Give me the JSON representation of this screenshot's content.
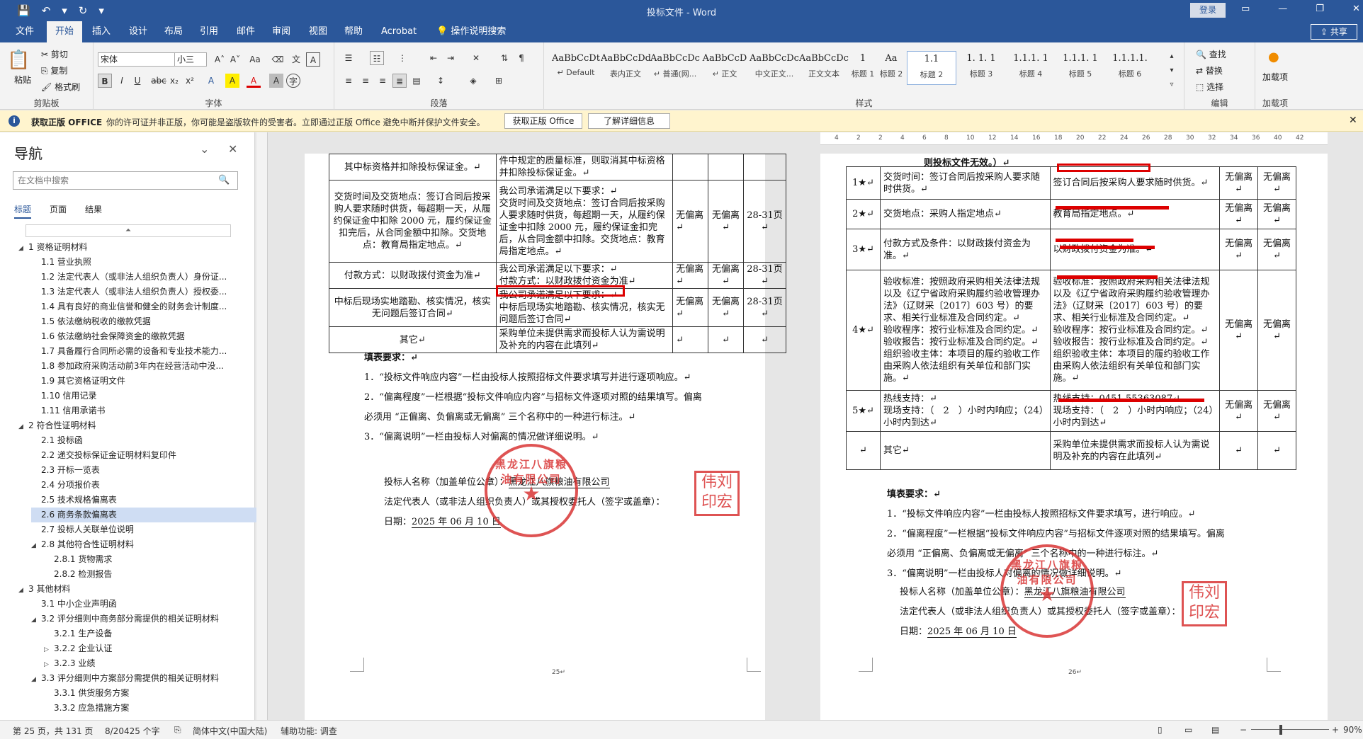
{
  "window": {
    "title": "投标文件 - Word",
    "login": "登录",
    "qat": [
      "💾",
      "↶",
      "▾",
      "↻",
      "▾"
    ],
    "winbtns": [
      "▭",
      "—",
      "❐",
      "✕"
    ]
  },
  "menu": {
    "tabs": [
      "文件",
      "开始",
      "插入",
      "设计",
      "布局",
      "引用",
      "邮件",
      "审阅",
      "视图",
      "帮助",
      "Acrobat",
      "操作说明搜索"
    ],
    "active": "开始",
    "share": "共享"
  },
  "ribbon": {
    "clipboard": {
      "paste": "粘贴",
      "cut": "剪切",
      "copy": "复制",
      "format_painter": "格式刷",
      "label": "剪贴板"
    },
    "font": {
      "name": "宋体",
      "size": "小三",
      "label": "字体",
      "buttons": [
        "B",
        "I",
        "U",
        "abc",
        "x₂",
        "x²",
        "A",
        "A",
        "A",
        "A"
      ],
      "top_buttons": [
        "A˄",
        "A˅",
        "Aa",
        "A"
      ]
    },
    "paragraph": {
      "label": "段落"
    },
    "styles": {
      "label": "样式",
      "items": [
        {
          "sample": "AaBbCcDt",
          "name": "↵ Default"
        },
        {
          "sample": "AaBbCcDdI",
          "name": "表内正文"
        },
        {
          "sample": "AaBbCcDc",
          "name": "↵ 普通(网..."
        },
        {
          "sample": "AaBbCcD",
          "name": "↵ 正文"
        },
        {
          "sample": "AaBbCcDc",
          "name": "中文正文..."
        },
        {
          "sample": "AaBbCcDc",
          "name": "正文文本"
        },
        {
          "sample": "1",
          "name": "标题 1"
        },
        {
          "sample": "Aa",
          "name": "标题 2"
        },
        {
          "sample": "1.1",
          "name": "标题 2"
        },
        {
          "sample": "1. 1. 1",
          "name": "标题 3"
        },
        {
          "sample": "1.1.1. 1",
          "name": "标题 4"
        },
        {
          "sample": "1.1.1. 1",
          "name": "标题 5"
        },
        {
          "sample": "1.1.1.1.",
          "name": "标题 6"
        }
      ],
      "selected_index": 8
    },
    "editing": {
      "find": "查找",
      "replace": "替换",
      "select": "选择",
      "label": "编辑"
    },
    "addins": {
      "name": "加载项",
      "label": "加载项"
    }
  },
  "warning": {
    "title": "获取正版 OFFICE",
    "text": "你的许可证并非正版，你可能是盗版软件的受害者。立即通过正版 Office 避免中断并保护文件安全。",
    "btn1": "获取正版 Office",
    "btn2": "了解详细信息"
  },
  "nav": {
    "title": "导航",
    "search_placeholder": "在文档中搜索",
    "tabs": [
      "标题",
      "页面",
      "结果"
    ],
    "items": [
      {
        "label": "1 资格证明材料",
        "level": 0,
        "arrow": "◢"
      },
      {
        "label": "1.1 营业执照",
        "level": 1,
        "arrow": ""
      },
      {
        "label": "1.2 法定代表人（或非法人组织负责人）身份证...",
        "level": 1,
        "arrow": ""
      },
      {
        "label": "1.3 法定代表人（或非法人组织负责人）授权委...",
        "level": 1,
        "arrow": ""
      },
      {
        "label": "1.4 具有良好的商业信誉和健全的财务会计制度...",
        "level": 1,
        "arrow": ""
      },
      {
        "label": "1.5 依法缴纳税收的缴款凭据",
        "level": 1,
        "arrow": ""
      },
      {
        "label": "1.6 依法缴纳社会保障资金的缴款凭据",
        "level": 1,
        "arrow": ""
      },
      {
        "label": "1.7 具备履行合同所必需的设备和专业技术能力...",
        "level": 1,
        "arrow": ""
      },
      {
        "label": "1.8 参加政府采购活动前3年内在经营活动中没...",
        "level": 1,
        "arrow": ""
      },
      {
        "label": "1.9 其它资格证明文件",
        "level": 1,
        "arrow": ""
      },
      {
        "label": "1.10 信用记录",
        "level": 1,
        "arrow": ""
      },
      {
        "label": "1.11 信用承诺书",
        "level": 1,
        "arrow": ""
      },
      {
        "label": "2 符合性证明材料",
        "level": 0,
        "arrow": "◢"
      },
      {
        "label": "2.1 投标函",
        "level": 1,
        "arrow": ""
      },
      {
        "label": "2.2 递交投标保证金证明材料复印件",
        "level": 1,
        "arrow": ""
      },
      {
        "label": "2.3 开标一览表",
        "level": 1,
        "arrow": ""
      },
      {
        "label": "2.4 分项报价表",
        "level": 1,
        "arrow": ""
      },
      {
        "label": "2.5 技术规格偏离表",
        "level": 1,
        "arrow": ""
      },
      {
        "label": "2.6 商务条款偏离表",
        "level": 1,
        "arrow": "",
        "selected": true
      },
      {
        "label": "2.7 投标人关联单位说明",
        "level": 1,
        "arrow": ""
      },
      {
        "label": "2.8 其他符合性证明材料",
        "level": 1,
        "arrow": "◢"
      },
      {
        "label": "2.8.1 货物需求",
        "level": 2,
        "arrow": ""
      },
      {
        "label": "2.8.2 检测报告",
        "level": 2,
        "arrow": ""
      },
      {
        "label": "3 其他材料",
        "level": 0,
        "arrow": "◢"
      },
      {
        "label": "3.1 中小企业声明函",
        "level": 1,
        "arrow": ""
      },
      {
        "label": "3.2 评分细则中商务部分需提供的相关证明材料",
        "level": 1,
        "arrow": "◢"
      },
      {
        "label": "3.2.1 生产设备",
        "level": 2,
        "arrow": ""
      },
      {
        "label": "3.2.2 企业认证",
        "level": 2,
        "arrow": "▷"
      },
      {
        "label": "3.2.3 业绩",
        "level": 2,
        "arrow": "▷"
      },
      {
        "label": "3.3 评分细则中方案部分需提供的相关证明材料",
        "level": 1,
        "arrow": "◢"
      },
      {
        "label": "3.3.1 供货服务方案",
        "level": 2,
        "arrow": ""
      },
      {
        "label": "3.3.2 应急措施方案",
        "level": 2,
        "arrow": ""
      }
    ]
  },
  "ruler": [
    "4",
    "2",
    "2",
    "4",
    "6",
    "8",
    "10",
    "12",
    "14",
    "16",
    "18",
    "20",
    "22",
    "24",
    "26",
    "28",
    "30",
    "32",
    "34",
    "36",
    "40",
    "42"
  ],
  "page_left": {
    "rows": [
      [
        "其中标资格并扣除投标保证金。↵",
        "件中规定的质量标准，则取消其中标资格并扣除投标保证金。↵",
        "",
        "",
        ""
      ],
      [
        "交货时间及交货地点：签订合同后按采购人要求随时供货，每超期一天，从履约保证金中扣除 2000 元，履约保证金扣完后，从合同金额中扣除。交货地点：教育局指定地点。↵",
        "我公司承诺满足以下要求：↵交货时间及交货地点：签订合同后按采购人要求随时供货，每超期一天，从履约保证金中扣除 2000 元，履约保证金扣完后，从合同金额中扣除。交货地点：教育局指定地点。↵",
        "无偏离↵",
        "无偏离↵",
        "28-31页↵"
      ],
      [
        "付款方式：以财政拨付资金为准↵",
        "我公司承诺满足以下要求：↵付款方式：以财政拨付资金为准↵",
        "无偏离↵",
        "无偏离↵",
        "28-31页↵"
      ],
      [
        "中标后现场实地踏勘、核实情况，核实无问题后签订合同↵",
        "我公司承诺满足以下要求：↵中标后现场实地踏勘、核实情况，核实无问题后签订合同↵",
        "无偏离↵",
        "无偏离↵",
        "28-31页↵"
      ],
      [
        "其它↵",
        "采购单位未提供需求而投标人认为需说明及补充的内容在此填列↵",
        "↵",
        "↵",
        "↵"
      ]
    ],
    "notes_title": "填表要求：↵",
    "notes": [
      "1．“投标文件响应内容”一栏由投标人按照招标文件要求填写并进行逐项响应。↵",
      "2．“偏离程度”一栏根据“投标文件响应内容”与招标文件逐项对照的结果填写。偏离",
      "必须用 “正偏离、负偏离或无偏离” 三个名称中的一种进行标注。↵",
      "3．“偏离说明”一栏由投标人对偏离的情况做详细说明。↵"
    ],
    "bidder_label": "投标人名称（加盖单位公章）：",
    "bidder_name": "黑龙江八旗粮油有限公司",
    "rep_label": "法定代表人（或非法人组织负责人）或其授权委托人（签字或盖章）：",
    "date_label": "日期：",
    "date": "2025 年 06 月 10 日",
    "seal_text": "黑龙江八旗粮油有限公司",
    "stamp_text": "伟刘印宏",
    "page_no": "25↵"
  },
  "page_right": {
    "top_text": "则投标文件无效。）↵",
    "rows": [
      [
        "1★↵",
        "交货时间：签订合同后按采购人要求随时供货。↵",
        "签订合同后按采购人要求随时供货。↵",
        "无偏离↵",
        "无偏离↵"
      ],
      [
        "2★↵",
        "交货地点：采购人指定地点↵",
        "教育局指定地点。↵",
        "无偏离↵",
        "无偏离↵"
      ],
      [
        "3★↵",
        "付款方式及条件：以财政拨付资金为准。↵",
        "以财政拨付资金为准。↵",
        "无偏离↵",
        "无偏离↵"
      ],
      [
        "4★↵",
        "验收标准：按照政府采购相关法律法规以及《辽宁省政府采购履约验收管理办法》（辽财采〔2017〕603 号）的要求、相关行业标准及合同约定。↵验收程序：按行业标准及合同约定。↵验收报告：按行业标准及合同约定。↵组织验收主体：本项目的履约验收工作由采购人依法组织有关单位和部门实施。↵",
        "验收标准：按照政府采购相关法律法规以及《辽宁省政府采购履约验收管理办法》（辽财采〔2017〕603 号）的要求、相关行业标准及合同约定。↵验收程序：按行业标准及合同约定。↵验收报告：按行业标准及合同约定。↵组织验收主体：本项目的履约验收工作由采购人依法组织有关单位和部门实施。↵",
        "无偏离↵",
        "无偏离↵"
      ],
      [
        "5★↵",
        "热线支持：↵现场支持：（　2　）小时内响应；（24）小时内到达↵",
        "热线支持：0451-55363087↵现场支持：（　2　）小时内响应；（24）小时内到达↵",
        "无偏离↵",
        "无偏离↵"
      ],
      [
        "↵",
        "其它↵",
        "采购单位未提供需求而投标人认为需说明及补充的内容在此填列↵",
        "↵",
        "↵"
      ]
    ],
    "notes_title": "填表要求：↵",
    "notes": [
      "1．“投标文件响应内容”一栏由投标人按照招标文件要求填写，进行响应。↵",
      "2．“偏离程度”一栏根据“投标文件响应内容”与招标文件逐项对照的结果填写。偏离",
      "必须用 “正偏离、负偏离或无偏离” 三个名称中的一种进行标注。↵",
      "3．“偏离说明”一栏由投标人对偏离的情况做详细说明。↵"
    ],
    "bidder_label": "投标人名称（加盖单位公章）：",
    "bidder_name": "黑龙江八旗粮油有限公司",
    "rep_label": "法定代表人（或非法人组织负责人）或其授权委托人（签字或盖章）：",
    "date_label": "日期：",
    "date": "2025 年 06 月 10 日",
    "seal_text": "黑龙江八旗粮油有限公司",
    "stamp_text": "伟刘印宏",
    "page_no": "26↵"
  },
  "status": {
    "page": "第 25 页，共 131 页",
    "words": "8/20425 个字",
    "lang": "简体中文(中国大陆)",
    "accessibility": "辅助功能: 调查",
    "zoom": "90%"
  },
  "colors": {
    "accent": "#2b579a",
    "seal": "#d93636",
    "warn": "#fff4ce"
  }
}
